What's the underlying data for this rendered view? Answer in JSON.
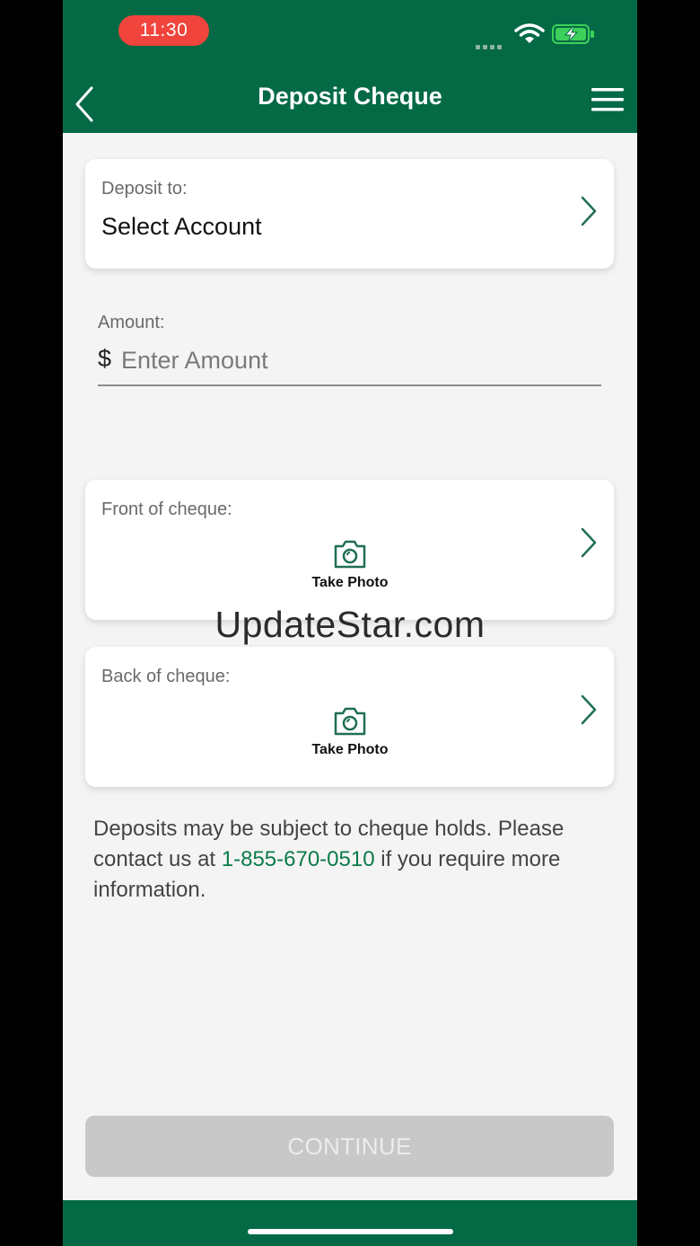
{
  "status_bar": {
    "time": "11:30"
  },
  "header": {
    "title": "Deposit Cheque"
  },
  "deposit_to": {
    "label": "Deposit to:",
    "value": "Select Account"
  },
  "amount": {
    "label": "Amount:",
    "currency_symbol": "$",
    "placeholder": "Enter Amount"
  },
  "front": {
    "label": "Front of cheque:",
    "action": "Take Photo"
  },
  "back": {
    "label": "Back of cheque:",
    "action": "Take Photo"
  },
  "watermark": "UpdateStar.com",
  "notice": {
    "before": "Deposits may be subject to cheque holds. Please contact us at ",
    "phone": "1-855-670-0510",
    "after": " if you require more information."
  },
  "continue_label": "CONTINUE",
  "colors": {
    "brand_green": "#046a45",
    "accent_link": "#0b7a49",
    "status_red": "#f0443c",
    "disabled_button": "#c8c8c8"
  },
  "icons": [
    "back-chevron-icon",
    "menu-icon",
    "wifi-icon",
    "battery-charging-icon",
    "chevron-right-icon",
    "camera-icon"
  ]
}
